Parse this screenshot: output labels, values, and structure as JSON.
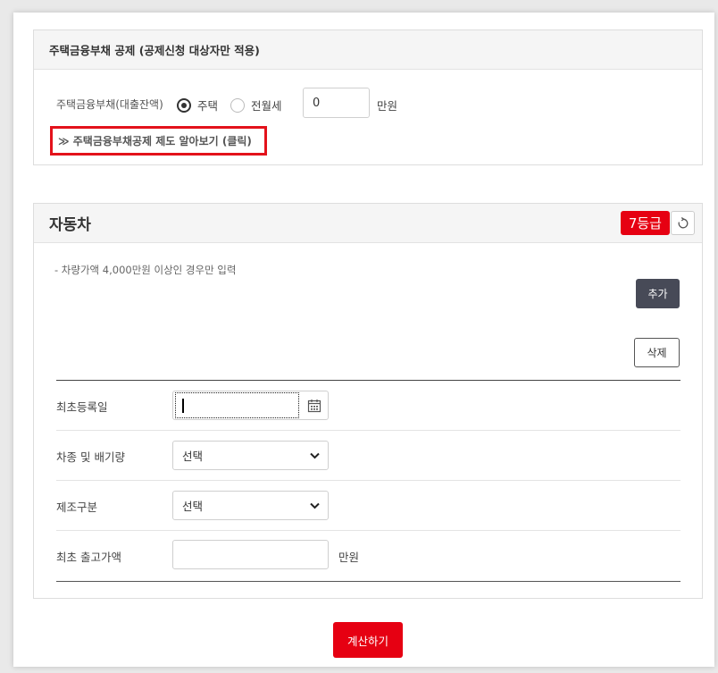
{
  "housing": {
    "title": "주택금융부채 공제 (공제신청 대상자만 적용)",
    "label": "주택금융부채(대출잔액)",
    "radio_house": "주택",
    "radio_rent": "전월세",
    "amount_value": "0",
    "unit": "만원",
    "learn_link": "≫ 주택금융부채공제 제도 알아보기 (클릭)"
  },
  "car": {
    "title": "자동차",
    "grade": "7등급",
    "note": "- 차량가액 4,000만원 이상인 경우만 입력",
    "add_label": "추가",
    "delete_label": "삭제",
    "rows": {
      "first_reg": {
        "label": "최초등록일",
        "value": ""
      },
      "type": {
        "label": "차종 및 배기량",
        "value": "선택"
      },
      "maker": {
        "label": "제조구분",
        "value": "선택"
      },
      "price": {
        "label": "최초 출고가액",
        "value": "",
        "unit": "만원"
      }
    }
  },
  "calc_label": "계산하기",
  "colors": {
    "accent": "#e60012",
    "dark_button": "#474a57"
  }
}
